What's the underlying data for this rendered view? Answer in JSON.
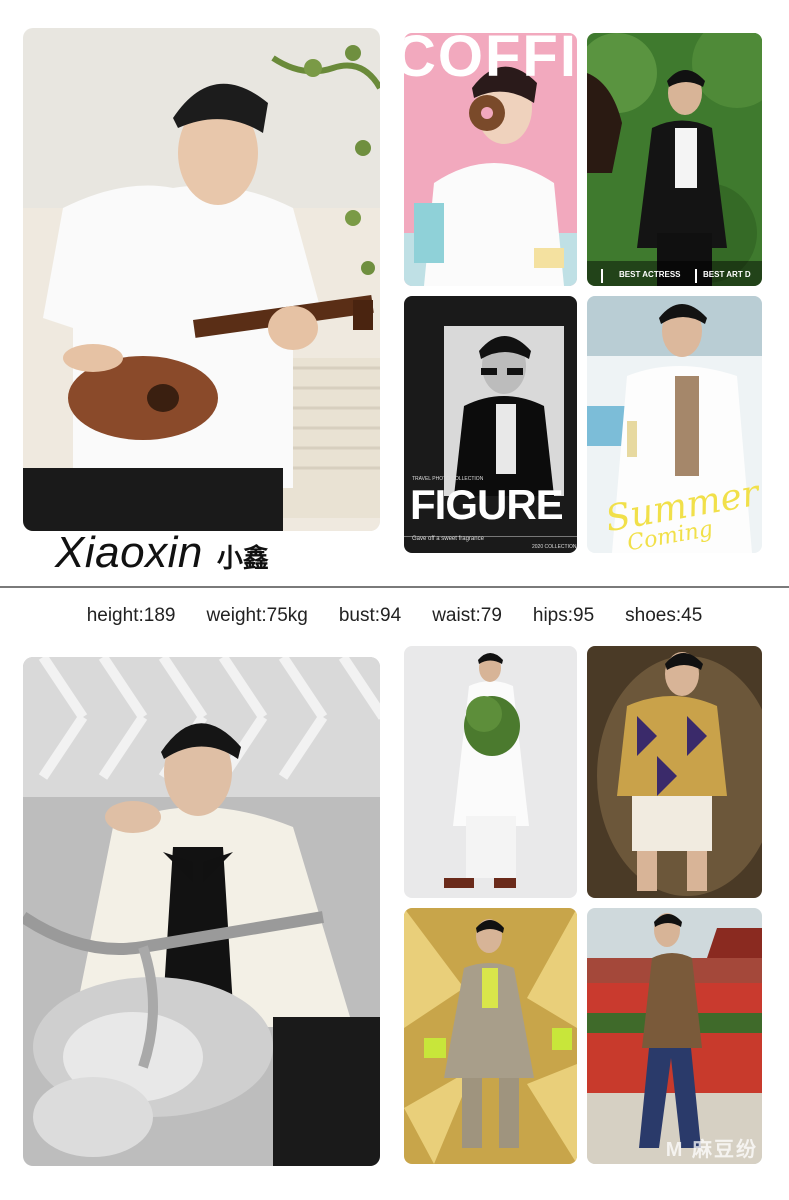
{
  "model": {
    "name_en": "Xiaoxin",
    "name_cn": "小鑫"
  },
  "stats": [
    {
      "label": "height:189"
    },
    {
      "label": "weight:75kg"
    },
    {
      "label": "bust:94"
    },
    {
      "label": "waist:79"
    },
    {
      "label": "hips:95"
    },
    {
      "label": "shoes:45"
    }
  ],
  "photos": {
    "magazine_pink": {
      "masthead": "COFFI"
    },
    "horse": {
      "caption_left": "BEST ACTRESS",
      "caption_right": "BEST ART D"
    },
    "figure_poster": {
      "title": "FIGURE",
      "subtitle": "Gave off a sweet fragrance",
      "collection": "2020 COLLECTION",
      "small_header": "TRAVEL PHOTO COLLECTION"
    },
    "summer": {
      "script": "Summer",
      "script2": "Coming"
    }
  },
  "watermark": "M 麻豆纷"
}
